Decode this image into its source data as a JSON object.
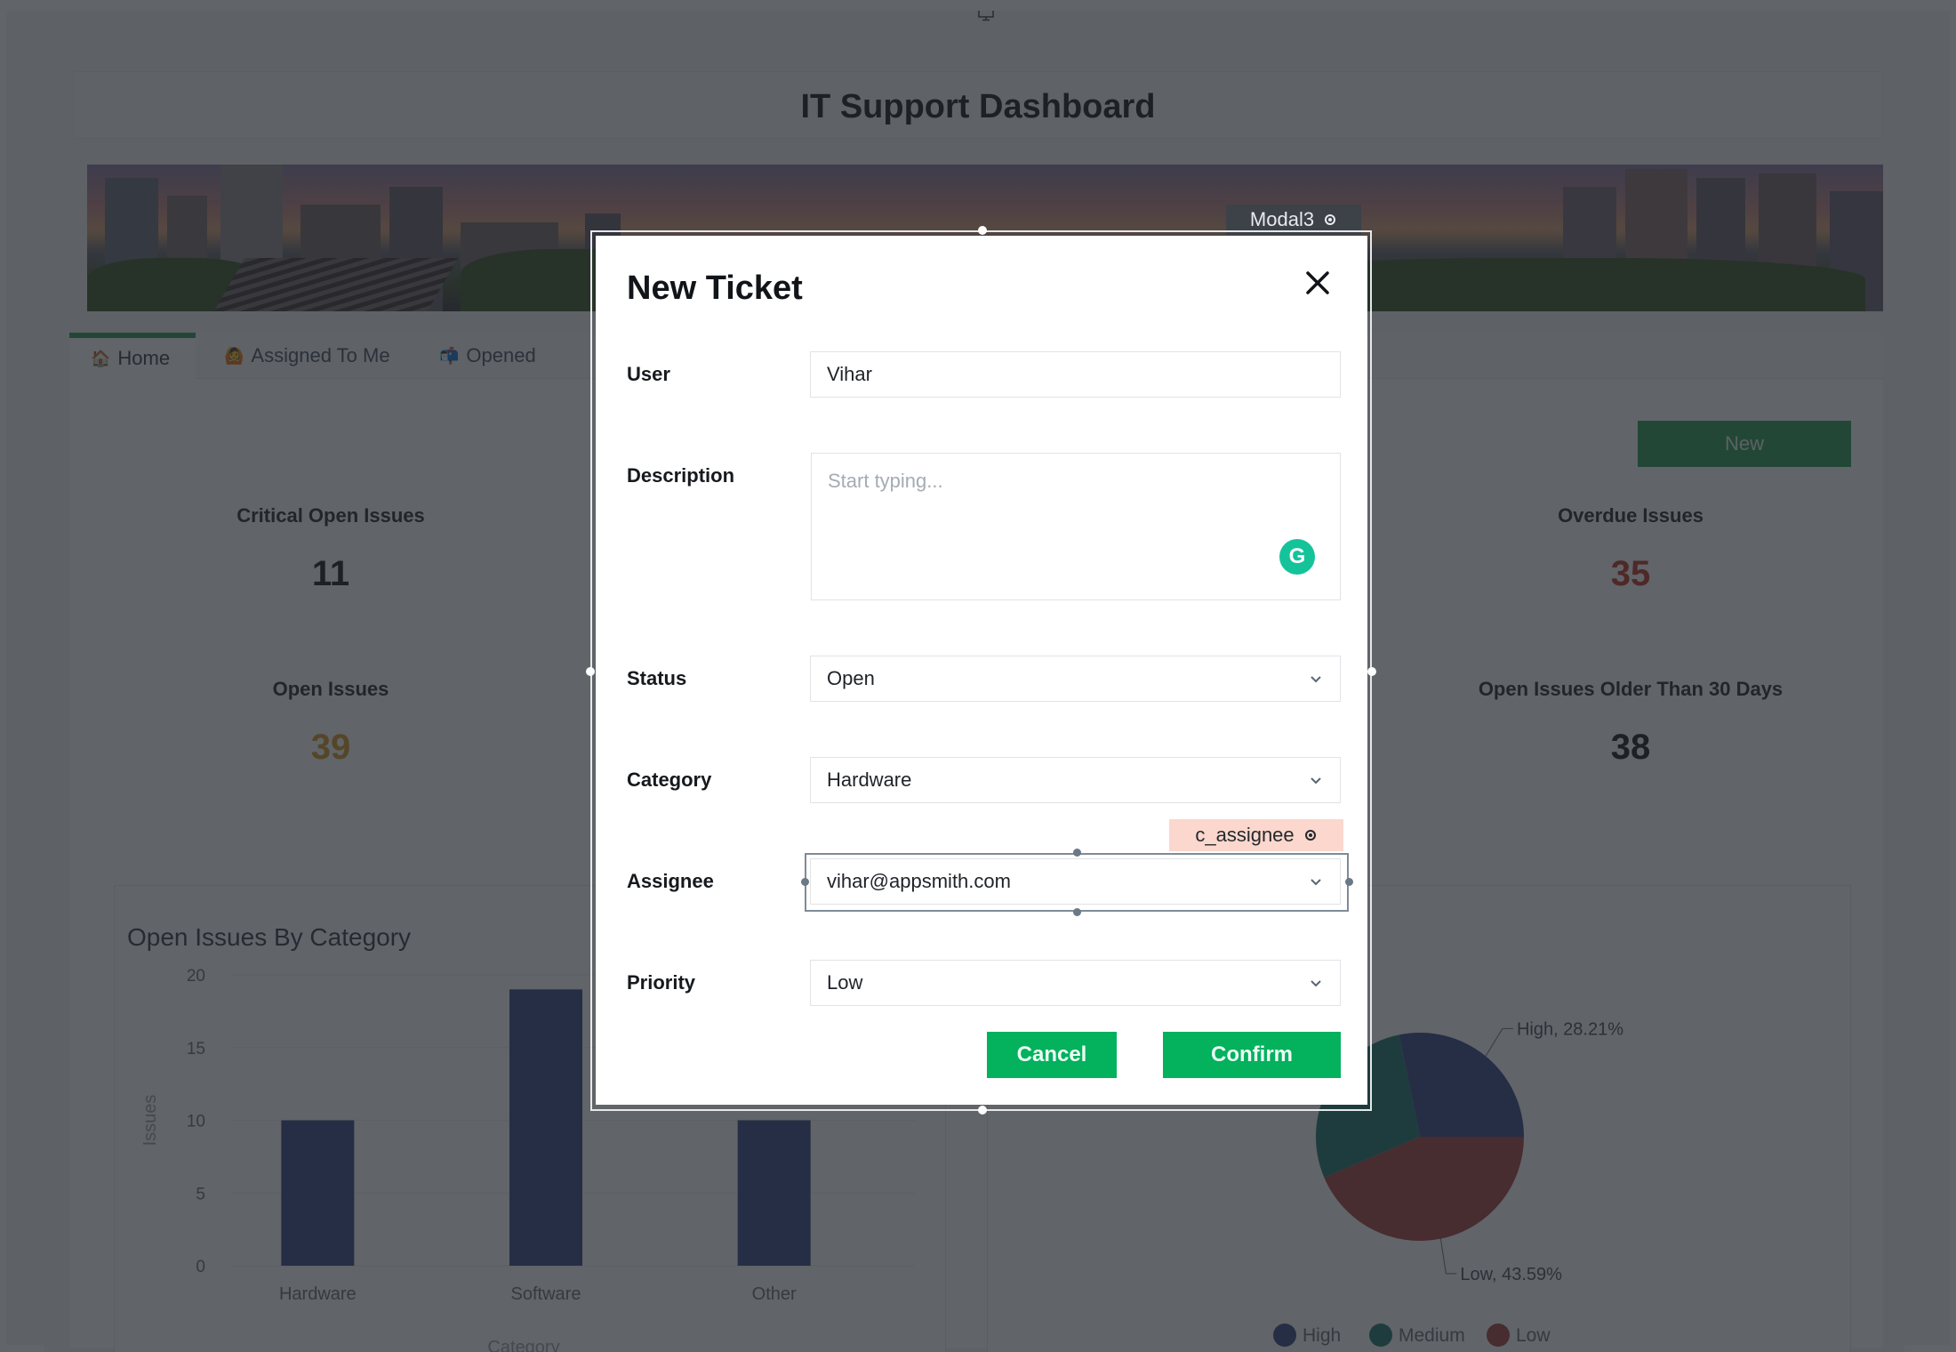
{
  "app": {
    "title": "IT Support Dashboard",
    "top_icon": "monitor-icon"
  },
  "tabs": [
    {
      "label": "Home",
      "icon": "🏠",
      "active": true
    },
    {
      "label": "Assigned To Me",
      "icon": "🙆",
      "active": false
    },
    {
      "label": "Opened",
      "icon": "📬",
      "active": false
    }
  ],
  "toolbar": {
    "new_label": "New"
  },
  "stats": {
    "critical_open": {
      "label": "Critical Open Issues",
      "value": "11",
      "color": "#1d1f23"
    },
    "open": {
      "label": "Open Issues",
      "value": "39",
      "color": "#d49a25"
    },
    "overdue": {
      "label": "Overdue Issues",
      "value": "35",
      "color": "#c0392b"
    },
    "older_30": {
      "label": "Open Issues Older Than 30 Days",
      "value": "38",
      "color": "#1d1f23"
    }
  },
  "chart_data": [
    {
      "type": "bar",
      "title": "Open Issues By Category",
      "categories": [
        "Hardware",
        "Software",
        "Other"
      ],
      "values": [
        10,
        19,
        10
      ],
      "xlabel": "Category",
      "ylabel": "Issues",
      "ylim": [
        0,
        20
      ],
      "yticks": [
        "0",
        "5",
        "10",
        "15",
        "20"
      ],
      "grid": true,
      "bar_color": "#3b4a8a"
    },
    {
      "type": "pie",
      "title": "",
      "slices": [
        {
          "label": "High",
          "value": 28.21,
          "color": "#3b4a8a",
          "data_label": "High, 28.21%"
        },
        {
          "label": "Medium",
          "value": 28.2,
          "color": "#1f7a73",
          "data_label": ""
        },
        {
          "label": "Low",
          "value": 43.59,
          "color": "#a84545",
          "data_label": "Low, 43.59%"
        }
      ],
      "legend": [
        "High",
        "Medium",
        "Low"
      ],
      "legend_position": "bottom"
    }
  ],
  "modal": {
    "widget_name": "Modal3",
    "title": "New Ticket",
    "close_icon": "close-icon",
    "fields": {
      "user": {
        "label": "User",
        "value": "Vihar"
      },
      "description": {
        "label": "Description",
        "value": "",
        "placeholder": "Start typing..."
      },
      "status": {
        "label": "Status",
        "value": "Open"
      },
      "category": {
        "label": "Category",
        "value": "Hardware"
      },
      "assignee": {
        "label": "Assignee",
        "value": "vihar@appsmith.com",
        "widget_name": "c_assignee"
      },
      "priority": {
        "label": "Priority",
        "value": "Low"
      }
    },
    "cancel_label": "Cancel",
    "confirm_label": "Confirm",
    "accent": "#04b15d"
  }
}
